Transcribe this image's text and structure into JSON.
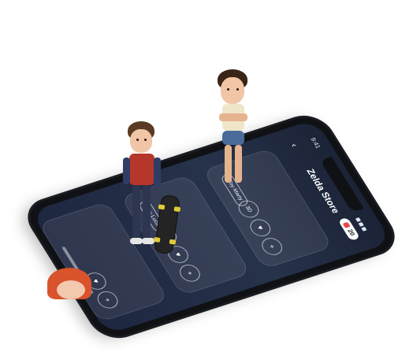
{
  "status_bar": {
    "time": "9:41"
  },
  "header": {
    "title": "Zelda Store",
    "back_icon": "chevron-left-icon",
    "cart_count": "20"
  },
  "cards": [
    {
      "price_label": "Toy Marty",
      "favorite_icon": "heart-icon",
      "add_icon": "plus-icon",
      "ar_label": "3D"
    },
    {
      "price_label": "Toy Luca",
      "favorite_icon": "heart-icon",
      "add_icon": "plus-icon",
      "ar_label": "3D"
    },
    {
      "price_label": "",
      "favorite_icon": "heart-icon",
      "add_icon": "plus-icon",
      "ar_label": ""
    }
  ],
  "colors": {
    "screen_bg": "#1b2336",
    "frame": "#0f1114",
    "badge_dot": "#e84848"
  }
}
